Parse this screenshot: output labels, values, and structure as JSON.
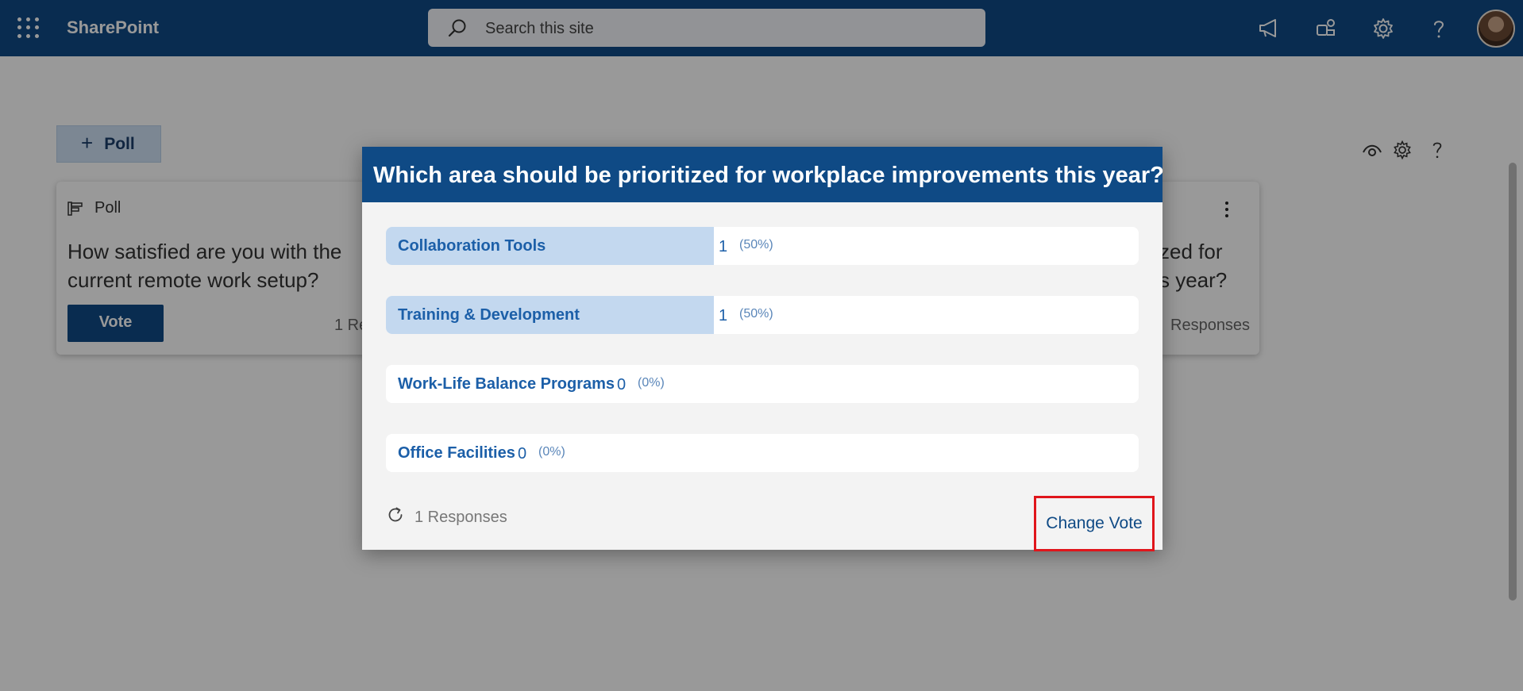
{
  "suitebar": {
    "brand": "SharePoint",
    "search_placeholder": "Search this site",
    "icons": [
      "app-launcher-icon",
      "megaphone-icon",
      "teams-icon",
      "gear-icon",
      "help-icon",
      "avatar"
    ]
  },
  "toolbar": {
    "add_poll_label": "Poll",
    "plus": "+"
  },
  "cards": [
    {
      "type_label": "Poll",
      "question": "How satisfied are you with the current remote work setup?",
      "vote_label": "Vote",
      "responses_fragment": "1 Re"
    },
    {
      "question_fragment_1": "zed for",
      "question_fragment_2": "s year?",
      "responses_fragment": "Responses"
    }
  ],
  "modal": {
    "title": "Which area should be prioritized for workplace improvements this year?",
    "options": [
      {
        "label": "Collaboration Tools",
        "count": "1",
        "pct": "(50%)",
        "fraction": 0.5
      },
      {
        "label": "Training & Development",
        "count": "1",
        "pct": "(50%)",
        "fraction": 0.5
      },
      {
        "label": "Work-Life Balance Programs",
        "count": "0",
        "pct": "(0%)",
        "fraction": 0
      },
      {
        "label": "Office Facilities",
        "count": "0",
        "pct": "(0%)",
        "fraction": 0
      }
    ],
    "responses": "1 Responses",
    "change_vote": "Change Vote"
  }
}
